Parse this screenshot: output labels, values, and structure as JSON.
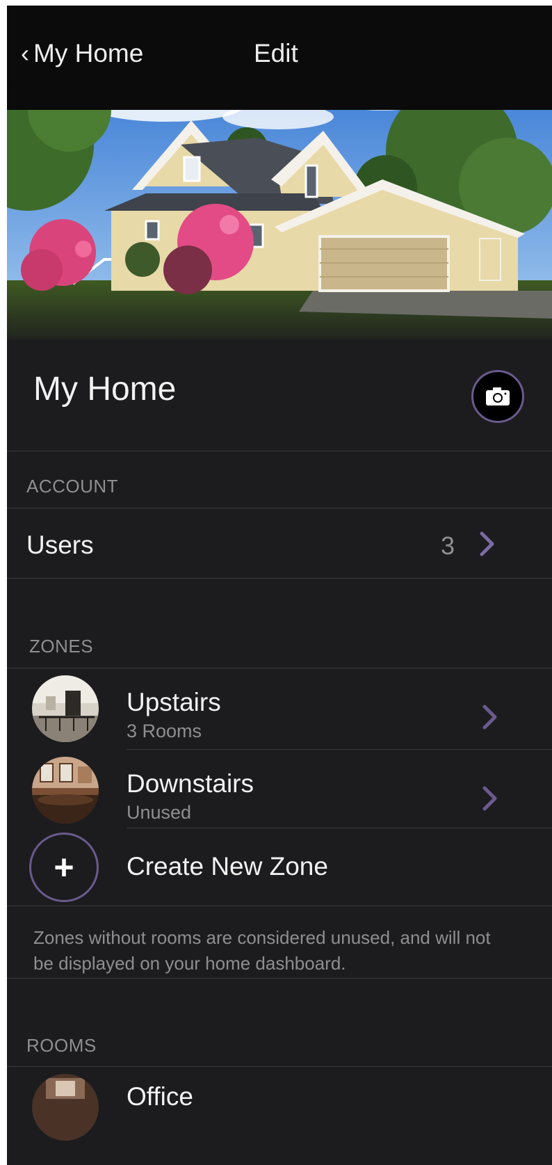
{
  "nav": {
    "back_label": "My Home",
    "title": "Edit"
  },
  "home": {
    "name": "My Home",
    "camera_icon": "camera-icon"
  },
  "account": {
    "section_label": "ACCOUNT",
    "users_label": "Users",
    "users_count": "3"
  },
  "zones": {
    "section_label": "ZONES",
    "items": [
      {
        "title": "Upstairs",
        "subtitle": "3 Rooms"
      },
      {
        "title": "Downstairs",
        "subtitle": "Unused"
      }
    ],
    "create_label": "Create New Zone",
    "note": "Zones without rooms are considered unused, and will not be displayed on your home dashboard."
  },
  "rooms": {
    "section_label": "ROOMS",
    "items": [
      {
        "title": "Office"
      }
    ]
  },
  "colors": {
    "background": "#1c1c1e",
    "navbar": "#0b0b0b",
    "accent": "#6a5a8e",
    "secondary_text": "#8e8e93"
  }
}
